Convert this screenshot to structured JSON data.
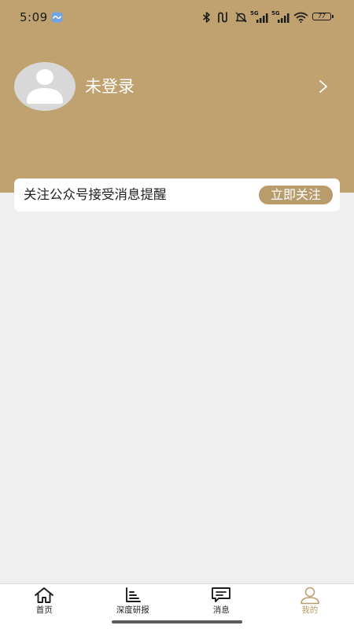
{
  "colors": {
    "brand": "#bfa26f",
    "button": "#b99c6b",
    "background": "#efefef",
    "active_tab": "#b99c6b"
  },
  "status_bar": {
    "time": "5:09",
    "signal_1": "5G",
    "signal_2": "5G",
    "battery": "77",
    "icons": [
      "app-notification-icon",
      "bluetooth-icon",
      "nfc-icon",
      "silent-icon",
      "cellular-signal-icon",
      "cellular-signal-icon",
      "wifi-icon",
      "battery-icon"
    ]
  },
  "profile": {
    "avatar_icon": "default-avatar-icon",
    "login_status": "未登录",
    "arrow_icon": "chevron-right-icon"
  },
  "follow_card": {
    "text": "关注公众号接受消息提醒",
    "button_label": "立即关注"
  },
  "tab_bar": {
    "items": [
      {
        "label": "首页",
        "icon": "home-icon",
        "active": false
      },
      {
        "label": "深度研报",
        "icon": "report-chart-icon",
        "active": false
      },
      {
        "label": "消息",
        "icon": "message-icon",
        "active": false
      },
      {
        "label": "我的",
        "icon": "person-icon",
        "active": true
      }
    ]
  }
}
